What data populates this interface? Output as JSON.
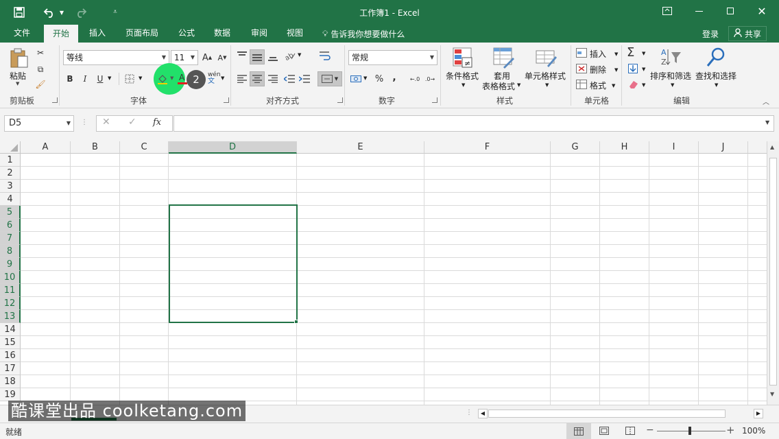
{
  "window": {
    "title": "工作簿1 - Excel",
    "colors": {
      "brand": "#217346",
      "accent_click": "#22e06a"
    }
  },
  "quick_access": {
    "save_icon": "save-icon",
    "undo_icon": "undo-icon",
    "redo_icon": "redo-icon",
    "customize_icon": "customize-qat-icon"
  },
  "tabs": [
    {
      "label": "文件"
    },
    {
      "label": "开始",
      "active": true
    },
    {
      "label": "插入"
    },
    {
      "label": "页面布局"
    },
    {
      "label": "公式"
    },
    {
      "label": "数据"
    },
    {
      "label": "审阅"
    },
    {
      "label": "视图"
    }
  ],
  "tell_me": "告诉我你想要做什么",
  "account": {
    "signin": "登录",
    "share": "共享"
  },
  "ribbon": {
    "clipboard": {
      "label": "剪贴板",
      "paste": "粘贴"
    },
    "font": {
      "label": "字体",
      "font_name": "等线",
      "font_size": "11",
      "grow": "A",
      "shrink": "A",
      "bold": "B",
      "italic": "I",
      "underline": "U",
      "phonetic": "wén",
      "step_badge": "2"
    },
    "alignment": {
      "label": "对齐方式"
    },
    "number": {
      "label": "数字",
      "format": "常规",
      "percent": "%",
      "comma": ","
    },
    "styles": {
      "label": "样式",
      "conditional": "条件格式",
      "table_line1": "套用",
      "table_line2": "表格格式",
      "cell_styles": "单元格样式"
    },
    "cells": {
      "label": "单元格",
      "insert": "插入",
      "delete": "删除",
      "format": "格式"
    },
    "editing": {
      "label": "编辑",
      "sort_filter": "排序和筛选",
      "find_select": "查找和选择"
    }
  },
  "formula_bar": {
    "name_box": "D5",
    "fx": "fx",
    "value": ""
  },
  "sheet": {
    "columns": [
      "A",
      "B",
      "C",
      "D",
      "E",
      "F",
      "G",
      "H",
      "I",
      "J"
    ],
    "selected_column": "D",
    "rows": [
      "1",
      "2",
      "3",
      "4",
      "5",
      "6",
      "7",
      "8",
      "9",
      "10",
      "11",
      "12",
      "13",
      "14",
      "15",
      "16",
      "17",
      "18",
      "19"
    ],
    "selected_rows": [
      "5",
      "6",
      "7",
      "8",
      "9",
      "10",
      "11",
      "12",
      "13"
    ],
    "selection": "D5:D13"
  },
  "status": {
    "ready": "就绪",
    "zoom": "100%"
  },
  "watermark": "酷课堂出品 coolketang.com"
}
